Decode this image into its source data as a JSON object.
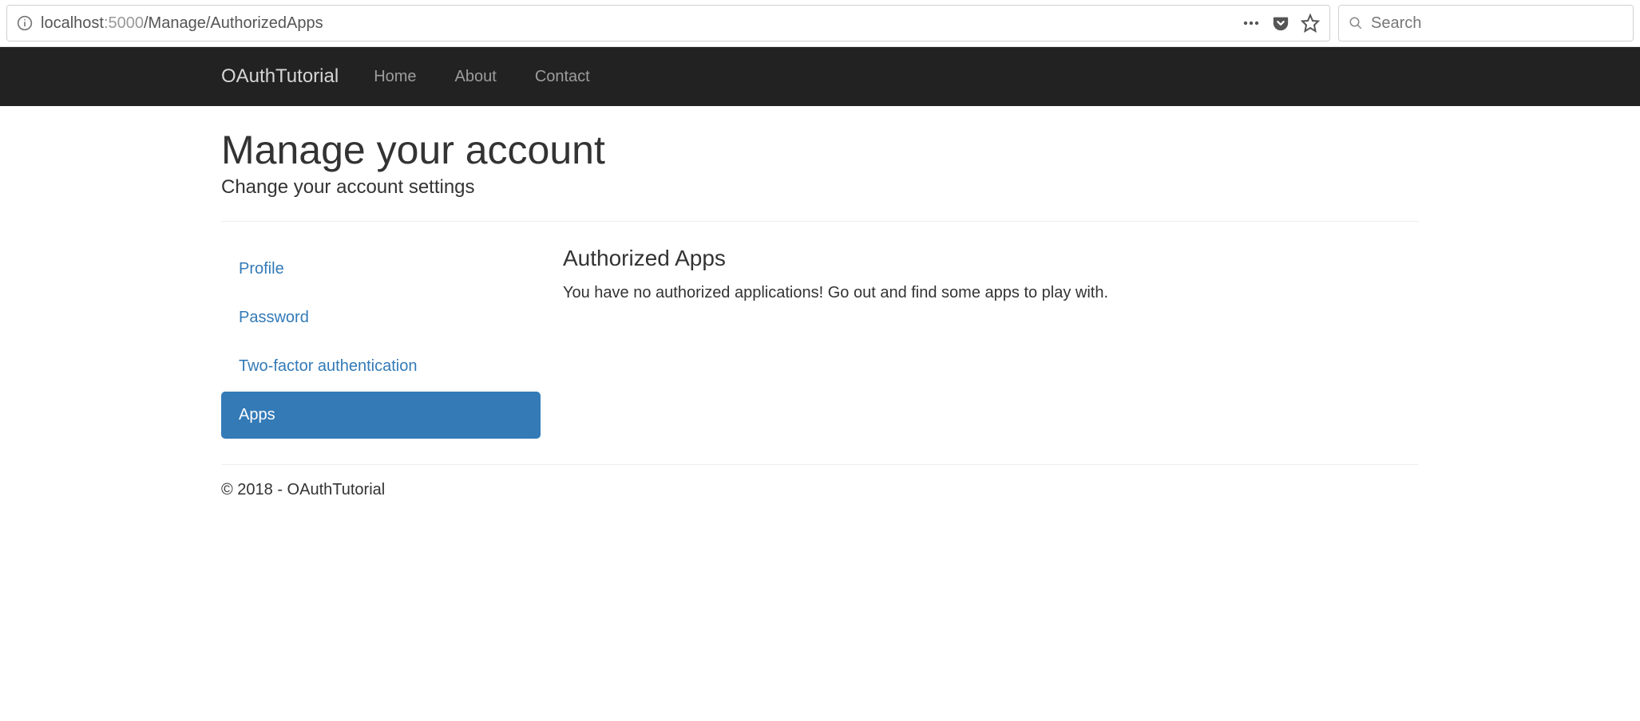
{
  "browser": {
    "url_host": "localhost",
    "url_port": ":5000",
    "url_path": "/Manage/AuthorizedApps",
    "search_placeholder": "Search"
  },
  "nav": {
    "brand": "OAuthTutorial",
    "links": [
      "Home",
      "About",
      "Contact"
    ]
  },
  "page": {
    "title": "Manage your account",
    "subtitle": "Change your account settings"
  },
  "sidebar": {
    "items": [
      {
        "label": "Profile",
        "active": false
      },
      {
        "label": "Password",
        "active": false
      },
      {
        "label": "Two-factor authentication",
        "active": false
      },
      {
        "label": "Apps",
        "active": true
      }
    ]
  },
  "main": {
    "heading": "Authorized Apps",
    "message": "You have no authorized applications! Go out and find some apps to play with."
  },
  "footer": {
    "text": "© 2018 - OAuthTutorial"
  }
}
